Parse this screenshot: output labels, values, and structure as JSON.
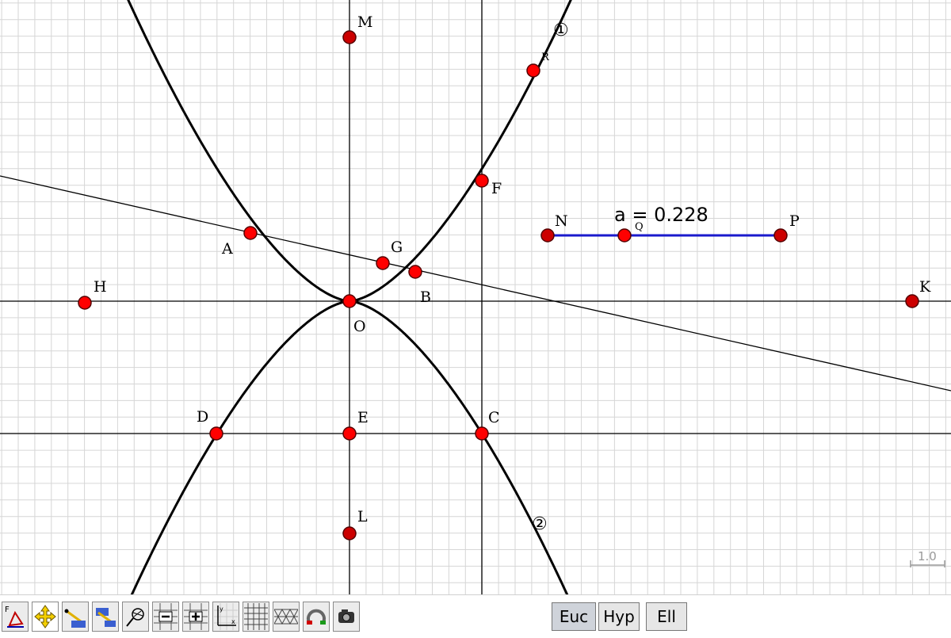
{
  "points": {
    "M": "M",
    "R": "R",
    "F": "F",
    "N": "N",
    "Q": "Q",
    "P": "P",
    "A": "A",
    "G": "G",
    "B": "B",
    "H": "H",
    "K": "K",
    "O": "O",
    "D": "D",
    "E": "E",
    "C": "C",
    "L": "L"
  },
  "parameter": {
    "label": "a = 0.228"
  },
  "curve_labels": {
    "first": "①",
    "second": "②"
  },
  "scale": {
    "value": "1.0"
  },
  "colors": {
    "point_fill": "#ff0000",
    "point_fill_dark": "#cc0000",
    "point_stroke": "#550000",
    "slider": "#1a1acc",
    "grid": "#d6d6d6",
    "curve": "#000000"
  },
  "toolbar": {
    "tools": [
      "format-icon",
      "move-icon",
      "segment-icon",
      "line-icon",
      "locus-icon",
      "grid-minus-icon",
      "grid-plus-icon",
      "axes-icon",
      "square-grid-icon",
      "triangle-grid-icon",
      "magnet-icon",
      "camera-icon"
    ],
    "geometry": [
      "Euc",
      "Hyp",
      "Ell"
    ],
    "selected_geometry": "Euc"
  }
}
